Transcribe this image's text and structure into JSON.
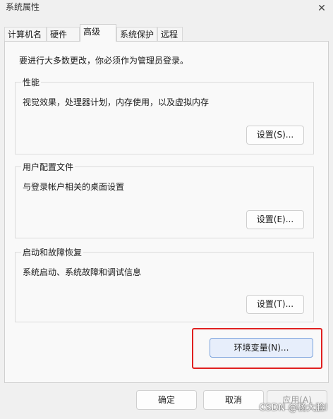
{
  "window": {
    "title": "系统属性",
    "close_symbol": "✕"
  },
  "tabs": [
    {
      "label": "计算机名"
    },
    {
      "label": "硬件"
    },
    {
      "label": "高级"
    },
    {
      "label": "系统保护"
    },
    {
      "label": "远程"
    }
  ],
  "active_tab": "高级",
  "panel": {
    "admin_note": "要进行大多数更改，你必须作为管理员登录。",
    "performance": {
      "title": "性能",
      "description": "视觉效果，处理器计划，内存使用，以及虚拟内存",
      "button": "设置(S)..."
    },
    "user_profiles": {
      "title": "用户配置文件",
      "description": "与登录帐户相关的桌面设置",
      "button": "设置(E)..."
    },
    "startup_recovery": {
      "title": "启动和故障恢复",
      "description": "系统启动、系统故障和调试信息",
      "button": "设置(T)..."
    },
    "env_button": "环境变量(N)..."
  },
  "footer": {
    "ok": "确定",
    "cancel": "取消",
    "apply": "应用(A)"
  },
  "watermark": "CSDN @杨大脸l",
  "colors": {
    "highlight": "#e02020",
    "env_button_bg": "#e7eefb",
    "env_button_border": "#7aa2dc"
  }
}
